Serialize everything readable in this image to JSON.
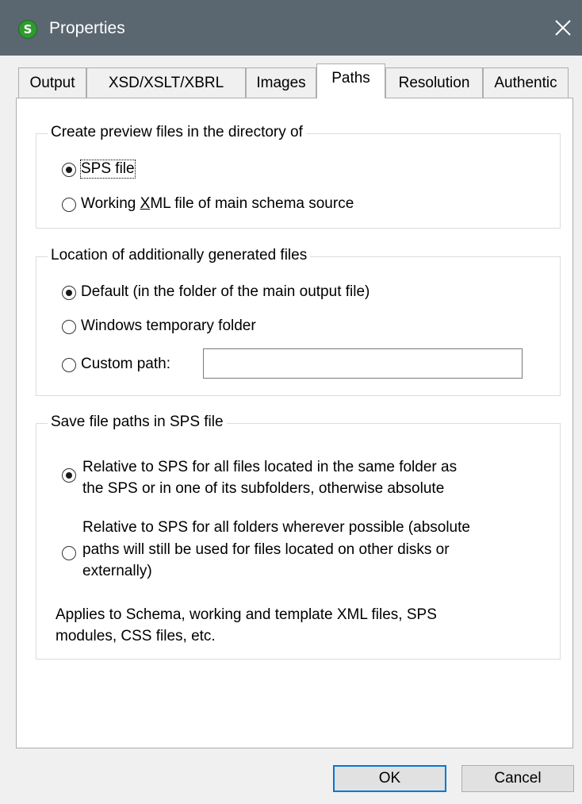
{
  "window": {
    "title": "Properties",
    "app_icon": "altova-stylevision-icon",
    "close_icon": "close-icon"
  },
  "tabs": [
    {
      "label": "Output"
    },
    {
      "label": "XSD/XSLT/XBRL"
    },
    {
      "label": "Images"
    },
    {
      "label": "Paths",
      "active": true
    },
    {
      "label": "Resolution"
    },
    {
      "label": "Authentic"
    }
  ],
  "preview_group": {
    "legend": "Create preview files in the directory of",
    "options": [
      {
        "label": "SPS file",
        "checked": true
      },
      {
        "label_pre": "Working ",
        "label_u": "X",
        "label_post": "ML file of main schema source",
        "checked": false
      }
    ]
  },
  "location_group": {
    "legend": "Location of additionally generated files",
    "options": [
      {
        "label": "Default (in the folder of the main output file)",
        "checked": true
      },
      {
        "label": "Windows temporary folder",
        "checked": false
      },
      {
        "label": "Custom path:",
        "checked": false
      }
    ],
    "custom_path_value": ""
  },
  "save_group": {
    "legend": "Save file paths in SPS file",
    "option1": {
      "line1": "Relative to SPS for all files located in the same folder as",
      "line2": "the SPS or in one of its subfolders, otherwise absolute",
      "checked": true
    },
    "option2": {
      "line1": "Relative to SPS for all folders wherever possible (absolute",
      "line2": "paths will still be used for files located on other disks or",
      "line3": "externally)",
      "checked": false
    },
    "note_line1": "Applies to Schema, working and template XML files, SPS",
    "note_line2": "modules, CSS files, etc."
  },
  "buttons": {
    "ok": "OK",
    "cancel": "Cancel"
  },
  "colors": {
    "titlebar": "#5a6670",
    "accent": "#0078d7"
  }
}
